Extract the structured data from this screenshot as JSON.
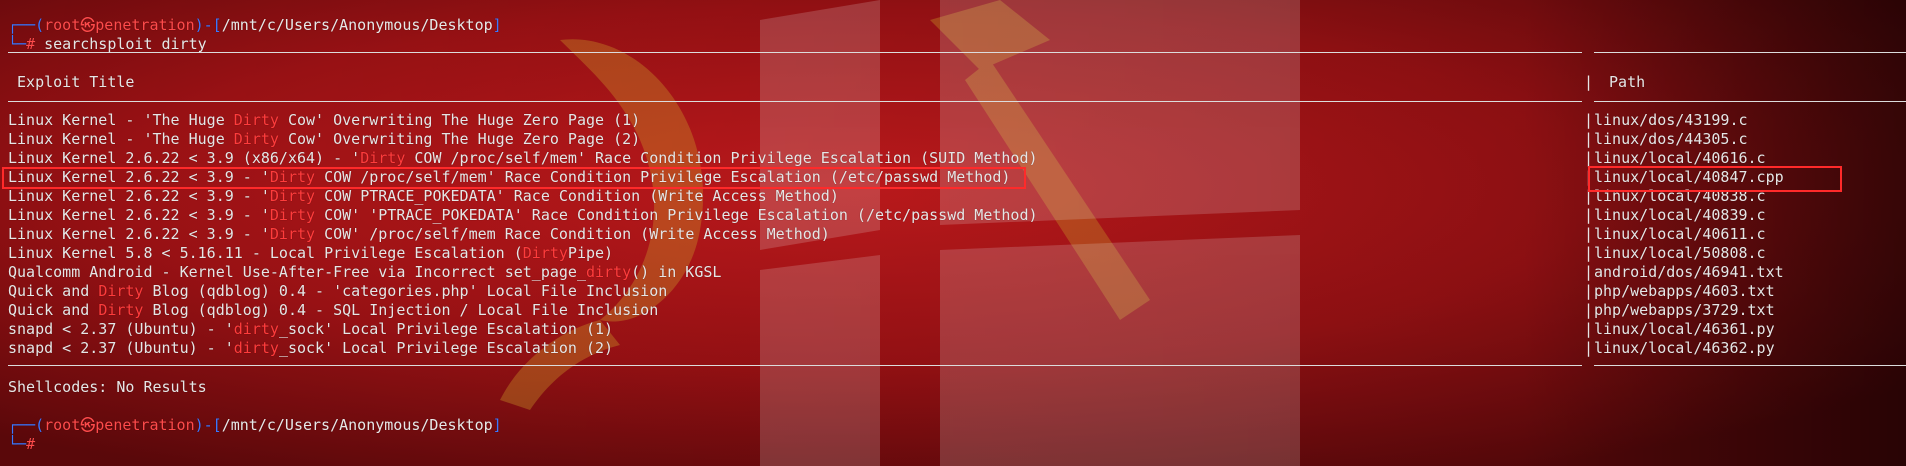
{
  "prompt1": {
    "corner_top": "┌──",
    "open_paren": "(",
    "user": "root",
    "at_sym": "㉿",
    "host": "penetration",
    "close_paren": ")",
    "dash": "-",
    "open_bracket": "[",
    "cwd": "/mnt/c/Users/Anonymous/Desktop",
    "close_bracket": "]",
    "corner_bottom": "└─",
    "hash": "#",
    "command": " searchsploit dirty"
  },
  "table": {
    "header_title": " Exploit Title",
    "header_sep": "|",
    "header_path": " Path",
    "rows": [
      {
        "pre": "Linux Kernel - 'The Huge ",
        "hl": "Dirty",
        "post": " Cow' Overwriting The Huge Zero Page (1)",
        "path": "linux/dos/43199.c"
      },
      {
        "pre": "Linux Kernel - 'The Huge ",
        "hl": "Dirty",
        "post": " Cow' Overwriting The Huge Zero Page (2)",
        "path": "linux/dos/44305.c"
      },
      {
        "pre": "Linux Kernel 2.6.22 < 3.9 (x86/x64) - '",
        "hl": "Dirty",
        "post": " COW /proc/self/mem' Race Condition Privilege Escalation (SUID Method)",
        "path": "linux/local/40616.c"
      },
      {
        "pre": "Linux Kernel 2.6.22 < 3.9 - '",
        "hl": "Dirty",
        "post": " COW /proc/self/mem' Race Condition Privilege Escalation (/etc/passwd Method)",
        "path": "linux/local/40847.cpp"
      },
      {
        "pre": "Linux Kernel 2.6.22 < 3.9 - '",
        "hl": "Dirty",
        "post": " COW PTRACE_POKEDATA' Race Condition (Write Access Method)",
        "path": "linux/local/40838.c"
      },
      {
        "pre": "Linux Kernel 2.6.22 < 3.9 - '",
        "hl": "Dirty",
        "post": " COW' 'PTRACE_POKEDATA' Race Condition Privilege Escalation (/etc/passwd Method)",
        "path": "linux/local/40839.c"
      },
      {
        "pre": "Linux Kernel 2.6.22 < 3.9 - '",
        "hl": "Dirty",
        "post": " COW' /proc/self/mem Race Condition (Write Access Method)",
        "path": "linux/local/40611.c"
      },
      {
        "pre": "Linux Kernel 5.8 < 5.16.11 - Local Privilege Escalation (",
        "hl": "Dirty",
        "post": "Pipe)",
        "path": "linux/local/50808.c"
      },
      {
        "pre": "Qualcomm Android - Kernel Use-After-Free via Incorrect set_page_",
        "hl": "dirty",
        "post": "() in KGSL",
        "path": "android/dos/46941.txt"
      },
      {
        "pre": "Quick and ",
        "hl": "Dirty",
        "post": " Blog (qdblog) 0.4 - 'categories.php' Local File Inclusion",
        "path": "php/webapps/4603.txt"
      },
      {
        "pre": "Quick and ",
        "hl": "Dirty",
        "post": " Blog (qdblog) 0.4 - SQL Injection / Local File Inclusion",
        "path": "php/webapps/3729.txt"
      },
      {
        "pre": "snapd < 2.37 (Ubuntu) - '",
        "hl": "dirty",
        "post": "_sock' Local Privilege Escalation (1)",
        "path": "linux/local/46361.py"
      },
      {
        "pre": "snapd < 2.37 (Ubuntu) - '",
        "hl": "dirty",
        "post": "_sock' Local Privilege Escalation (2)",
        "path": "linux/local/46362.py"
      }
    ],
    "row_sep": "|"
  },
  "shellcodes": "Shellcodes: No Results",
  "prompt2": {
    "corner_top": "┌──",
    "open_paren": "(",
    "user": "root",
    "at_sym": "㉿",
    "host": "penetration",
    "close_paren": ")",
    "dash": "-",
    "open_bracket": "[",
    "cwd": "/mnt/c/Users/Anonymous/Desktop",
    "close_bracket": "]",
    "corner_bottom": "└─",
    "hash": "#"
  },
  "colors": {
    "prompt_blue": "#3b78ff",
    "prompt_red": "#ff4b4b",
    "highlight_red": "#ff3c3c",
    "text": "#e6e6e6",
    "annotation_box": "#ff2a2a",
    "wallpaper_red": "#7a0d10"
  }
}
